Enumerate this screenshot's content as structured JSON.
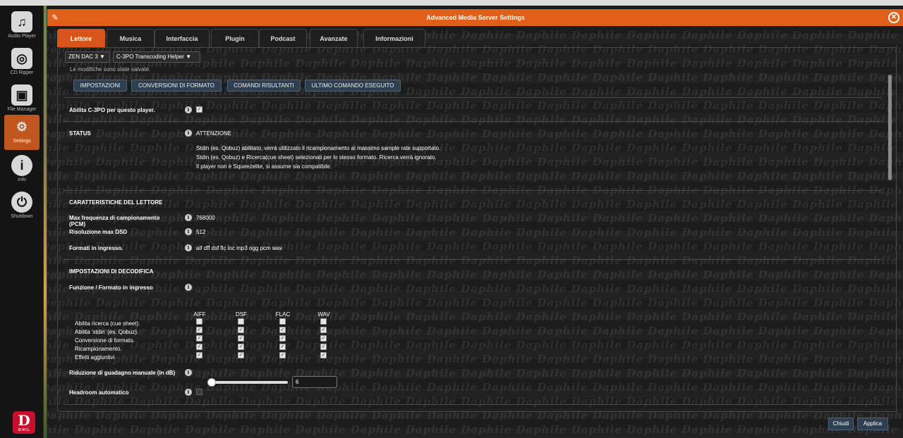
{
  "rail": {
    "items": [
      {
        "label": "Audio Player",
        "glyph": "♫"
      },
      {
        "label": "CD Ripper",
        "glyph": "◎"
      },
      {
        "label": "File Manager",
        "glyph": "▣"
      },
      {
        "label": "Settings",
        "glyph": "⚙"
      },
      {
        "label": "Info",
        "glyph": "i"
      },
      {
        "label": "Shutdown",
        "glyph": "⏻"
      }
    ],
    "active": "Settings",
    "logo_letter": "D"
  },
  "dialog": {
    "title": "Advanced Media Server Settings",
    "accent": "#e0601a"
  },
  "tabs": [
    "Lettore",
    "Musica",
    "Interfaccia",
    "Plugin",
    "Podcast",
    "Avanzate",
    "Informazioni"
  ],
  "active_tab": "Lettore",
  "watermark": "Daphile",
  "selectors": {
    "player": "ZEN DAC 3 ▼",
    "plugin": "C-3PO Transcoding Helper ▼"
  },
  "saved_note": "Le modifiche sono state salvate.",
  "subbuttons": [
    "IMPOSTAZIONI",
    "CONVERSIONI DI FORMATO",
    "COMANDI RISULTANTI",
    "ULTIMO COMANDO ESEGUITO"
  ],
  "enable": {
    "label": "Abilita C-3PO per questo player.",
    "checked": true
  },
  "status": {
    "label": "STATUS",
    "value": "ATTENZIONE",
    "lines": [
      "Stdin (es. Qobuz) abilitato, verrà utilizzato il ricampionamento al massimo sample rate supportato.",
      "Stdin (es. Qobuz) e Ricerca(cue sheet) selezionati per lo stesso formato. Ricerca verrà ignorato.",
      "Il player non è Squeezelite, si assume sia compatibile."
    ]
  },
  "player_caps": {
    "section": "CARATTERISTICHE DEL LETTORE",
    "pcm_label": "Max frequenza di campionamento (PCM)",
    "pcm_value": "768000",
    "dsd_label": "Risoluzione max DSD",
    "dsd_value": "512",
    "formats_label": "Formati in ingresso.",
    "formats_value": "aif dff dsf flc loc mp3 ogg pcm wav"
  },
  "decoding": {
    "section": "IMPOSTAZIONI DI DECODIFICA",
    "function_label": "Funzione / Formato in ingresso",
    "columns": [
      "AIFF",
      "DSF",
      "FLAC",
      "WAV"
    ],
    "rows": [
      {
        "label": "Abilita ricerca (cue sheet).",
        "values": [
          false,
          false,
          false,
          false
        ]
      },
      {
        "label": "Abilita 'stdin' (es. Qobuz).",
        "values": [
          true,
          true,
          true,
          true
        ]
      },
      {
        "label": "Conversione di formato.",
        "values": [
          true,
          true,
          true,
          true
        ]
      },
      {
        "label": "Ricampionamento.",
        "values": [
          true,
          true,
          true,
          true
        ]
      },
      {
        "label": "Effetti aggiuntivi",
        "values": [
          true,
          true,
          true,
          true
        ]
      }
    ]
  },
  "gain": {
    "label": "Riduzione di guadagno manuale (in dB)",
    "value": "6",
    "slider_fraction": 0.05
  },
  "headroom": {
    "label": "Headroom automatico",
    "checked": false
  },
  "footer": {
    "close": "Chiudi",
    "apply": "Applica"
  }
}
